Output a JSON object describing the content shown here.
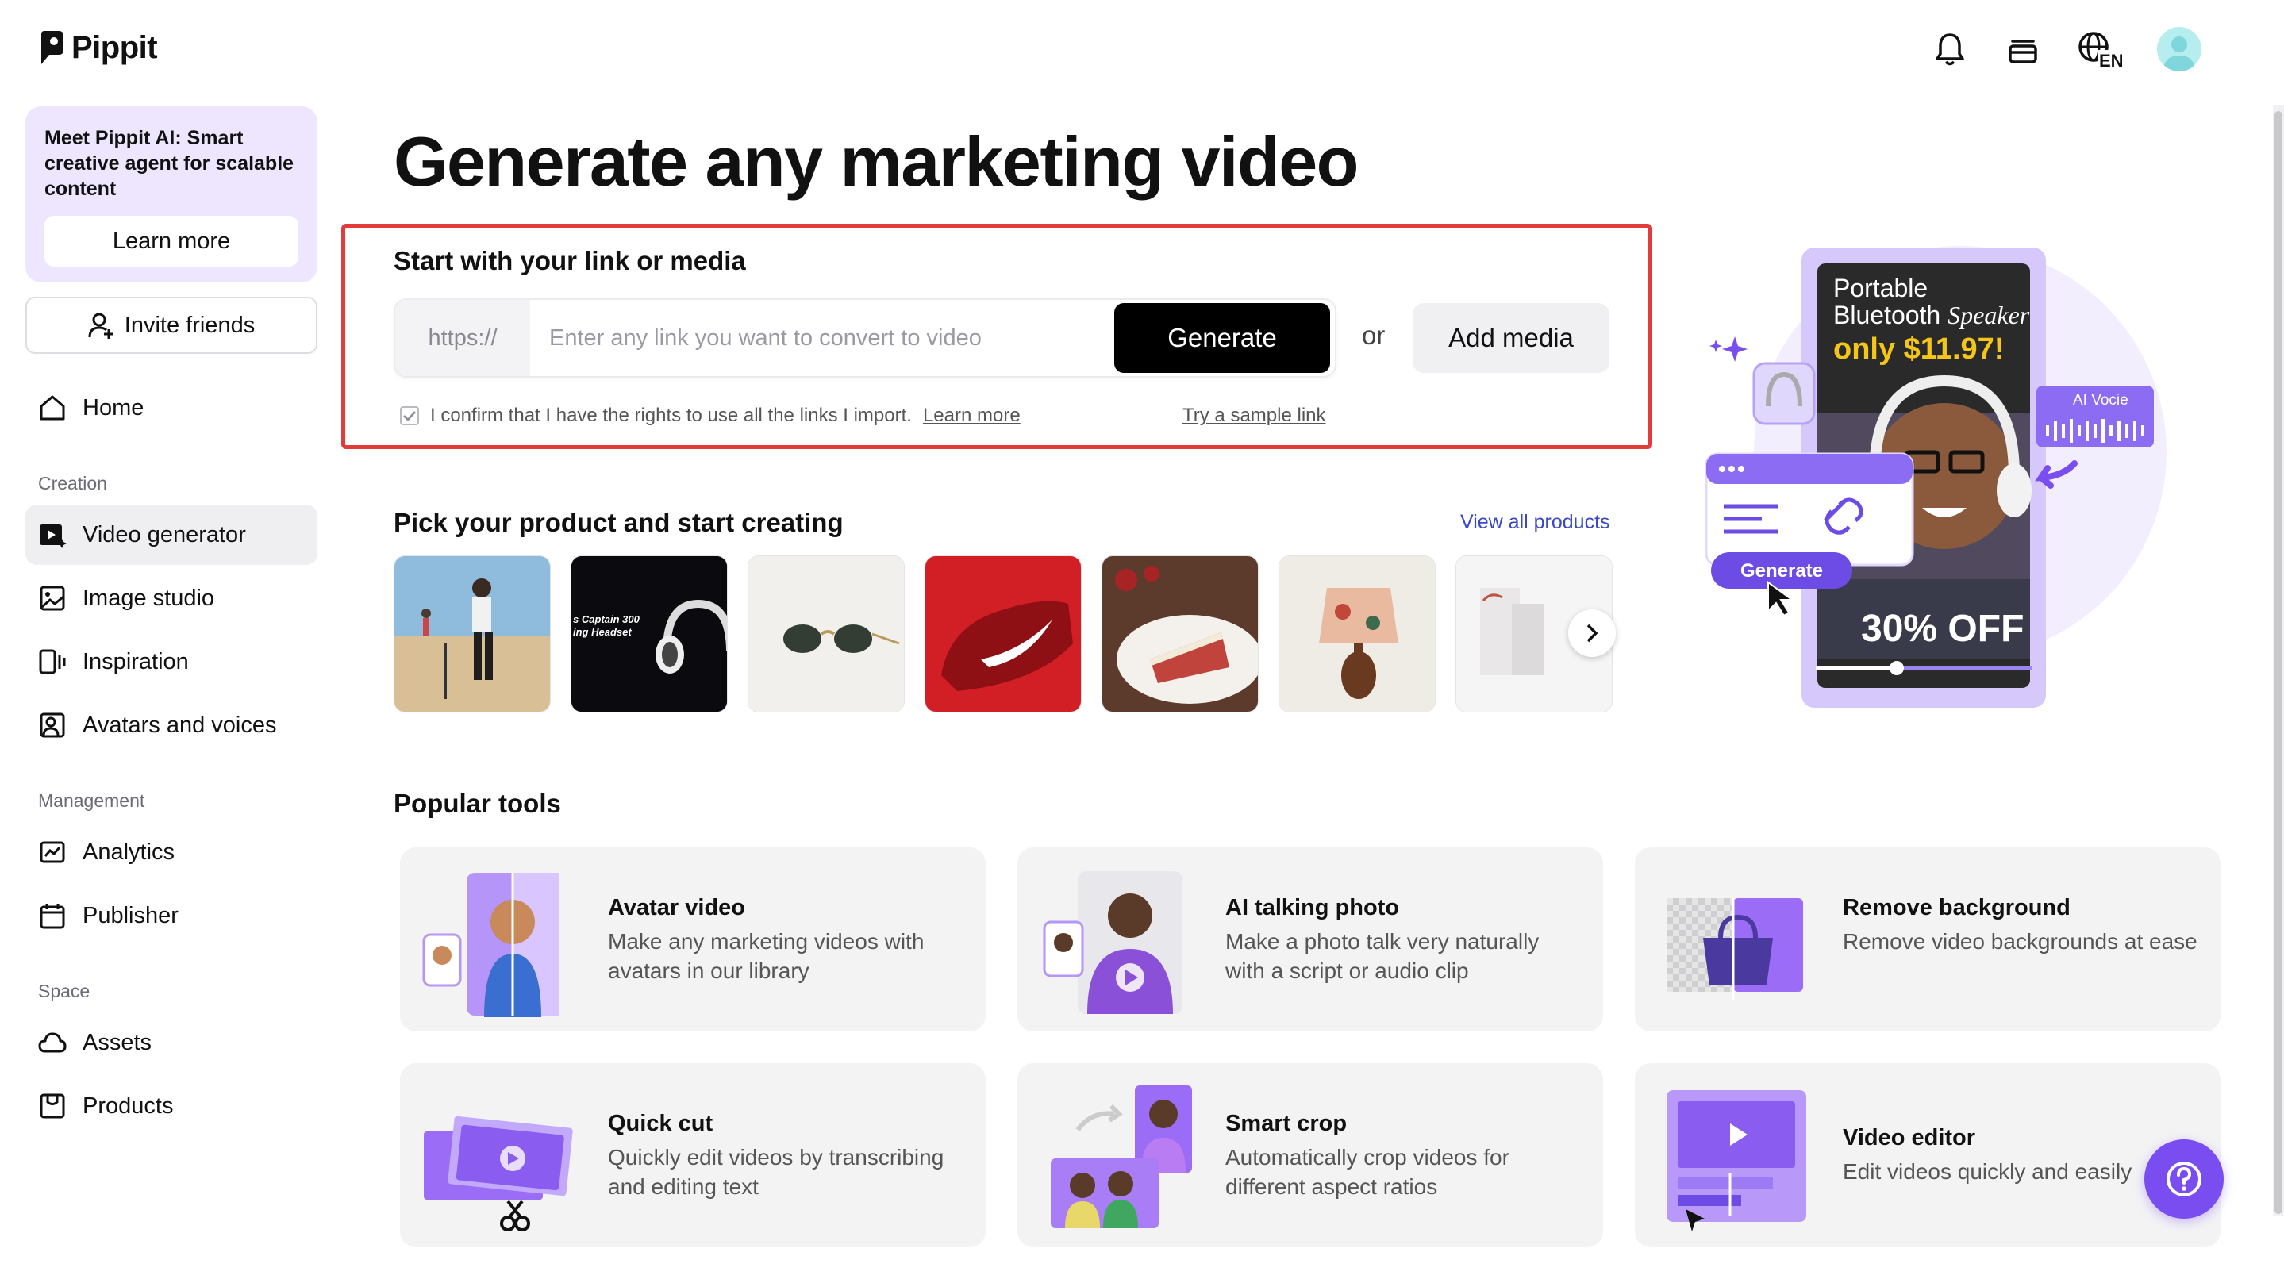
{
  "app": {
    "logo_text": "Pippit"
  },
  "header": {
    "icons": [
      "bell-icon",
      "stack-icon",
      "globe-language-icon",
      "avatar"
    ],
    "language_badge": "EN"
  },
  "sidebar": {
    "promo": {
      "title": "Meet Pippit AI:",
      "body": " Smart creative agent for scalable content",
      "button": "Learn more"
    },
    "invite_label": "Invite friends",
    "home_label": "Home",
    "sections": {
      "creation": "Creation",
      "management": "Management",
      "space": "Space"
    },
    "creation_items": [
      {
        "label": "Video generator",
        "icon": "video-generator-icon",
        "active": true
      },
      {
        "label": "Image studio",
        "icon": "image-studio-icon"
      },
      {
        "label": "Inspiration",
        "icon": "inspiration-icon"
      },
      {
        "label": "Avatars and voices",
        "icon": "avatar-voice-icon"
      }
    ],
    "management_items": [
      {
        "label": "Analytics",
        "icon": "analytics-icon"
      },
      {
        "label": "Publisher",
        "icon": "calendar-icon"
      }
    ],
    "space_items": [
      {
        "label": "Assets",
        "icon": "cloud-icon"
      },
      {
        "label": "Products",
        "icon": "product-box-icon"
      }
    ]
  },
  "main": {
    "title": "Generate any marketing video",
    "start": {
      "label": "Start with your link or media",
      "url_prefix": "https://",
      "url_placeholder": "Enter any link you want to convert to video",
      "url_value": "",
      "generate_button": "Generate",
      "or_text": "or",
      "add_media_button": "Add media",
      "confirm_text": "I confirm that I have the rights to use all the links I import.",
      "confirm_link": "Learn more",
      "try_sample": "Try a sample link",
      "confirm_checked": true
    },
    "products": {
      "title": "Pick your product and start creating",
      "view_all": "View all products",
      "thumb_texts": {
        "headset_line1": "s Captain 300",
        "headset_line2": "ing Headset"
      }
    },
    "hero": {
      "product_line1": "Portable",
      "product_line2": "Bluetooth",
      "product_line2_italic": "Speaker",
      "price": "only $11.97!",
      "discount": "30% OFF",
      "voice_badge": "AI Vocie",
      "generate_label": "Generate"
    },
    "tools": {
      "title": "Popular tools",
      "items": [
        {
          "name": "Avatar video",
          "desc": "Make any marketing videos with avatars in our library"
        },
        {
          "name": "AI talking photo",
          "desc": "Make a photo talk very naturally with a script or audio clip"
        },
        {
          "name": "Remove background",
          "desc": "Remove video backgrounds at ease"
        },
        {
          "name": "Quick cut",
          "desc": "Quickly edit videos by transcribing and editing text"
        },
        {
          "name": "Smart crop",
          "desc": "Automatically crop videos for different aspect ratios"
        },
        {
          "name": "Video editor",
          "desc": "Edit videos quickly and easily"
        }
      ]
    }
  },
  "colors": {
    "accent_purple": "#7a4df0",
    "highlight_red": "#e33b3b",
    "link_blue": "#3a47c8",
    "promo_bg": "#eee6fe"
  }
}
